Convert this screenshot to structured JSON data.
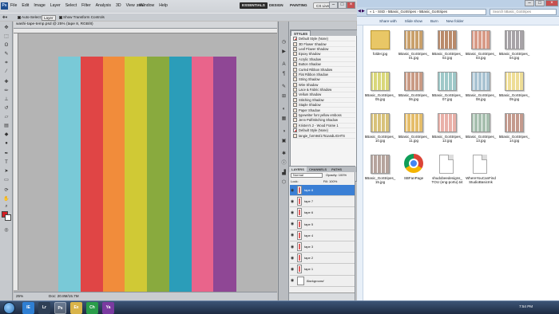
{
  "photoshop": {
    "app_icon": "Ps",
    "menus": [
      "File",
      "Edit",
      "Image",
      "Layer",
      "Select",
      "Filter",
      "Analysis",
      "3D",
      "View",
      "Window",
      "Help"
    ],
    "zoom": "25%",
    "workspaces": [
      "ESSENTIALS",
      "DESIGN",
      "PAINTING"
    ],
    "cs_live": "CS Live",
    "options": {
      "auto_select": "Auto-Select:",
      "layer": "Layer",
      "show_transform": "Show Transform Controls"
    },
    "document_tab": "washi-tape-temp.psd @ 25% (tape 8, RGB/8)",
    "status_zoom": "25%",
    "status_doc": "Doc: 20.8M/15.7M",
    "stripe_colors": [
      "#79c9d7",
      "#e04545",
      "#f18c3b",
      "#d0c935",
      "#89aa3e",
      "#2b9db9",
      "#e9648b",
      "#8f4795"
    ],
    "fg_color": "#d31e23",
    "bg_color": "#ffffff"
  },
  "styles_panel": {
    "tab": "STYLES",
    "items": [
      "Default Style (None)",
      "3D Flower Shadow",
      "Leaf Flower Shadow",
      "Epoxy Shadow",
      "Acrylic Shadow",
      "Button Shadow",
      "Curled Ribbon Shadow",
      "Flat Ribbon Shadow",
      "String Shadow",
      "Wire Shadow",
      "Lace & Fabric Shadow",
      "Vellum Shadow",
      "Stitching Shadow",
      "Staple Shadow",
      "Paper Shadow",
      "typewriter font yellow emboss",
      "Jenn Paf/Stitching Shadow",
      "Kristen's 2 - Wood Frame 1",
      "Default Style (None)",
      "tangie_form94/1751andLIGHTS"
    ]
  },
  "layers_panel": {
    "tabs": [
      "LAYERS",
      "CHANNELS",
      "PATHS"
    ],
    "blend": "Normal",
    "opacity": "Opacity: 100%",
    "lock": "Lock:",
    "fill": "Fill: 100%",
    "layers": [
      "tape 8",
      "tape 7",
      "tape 6",
      "tape 5",
      "tape 4",
      "tape 3",
      "tape 2",
      "tape 1",
      "Background"
    ]
  },
  "explorer": {
    "breadcrumb": "« 1 - SSD › 5Basic_GoStripes › 5Basic_GoStripes",
    "search_placeholder": "Search 5Basic_GoStripes",
    "toolbar": [
      "Share with",
      "Slide show",
      "Burn",
      "New folder"
    ],
    "files": [
      {
        "name": "folder.jpg",
        "type": "folder",
        "color": "#e9c766"
      },
      {
        "name": "5Basic_GoStripes_01.jpg",
        "type": "image",
        "color": "#c9a06b"
      },
      {
        "name": "5Basic_GoStripes_02.jpg",
        "type": "image",
        "color": "#b98a6a"
      },
      {
        "name": "5Basic_GoStripes_03.jpg",
        "type": "image",
        "color": "#d89a86"
      },
      {
        "name": "5Basic_GoStripes_04.jpg",
        "type": "image",
        "color": "#a7a3a7"
      },
      {
        "name": "5Basic_GoStripes_05.jpg",
        "type": "image",
        "color": "#d9d77a"
      },
      {
        "name": "5Basic_GoStripes_06.jpg",
        "type": "image",
        "color": "#c99a84"
      },
      {
        "name": "5Basic_GoStripes_07.jpg",
        "type": "image",
        "color": "#9ec8c8"
      },
      {
        "name": "5Basic_GoStripes_08.jpg",
        "type": "image",
        "color": "#a9c3d2"
      },
      {
        "name": "5Basic_GoStripes_09.jpg",
        "type": "image",
        "color": "#eedd96"
      },
      {
        "name": "5Basic_GoStripes_10.jpg",
        "type": "image",
        "color": "#d8c27a"
      },
      {
        "name": "5Basic_GoStripes_11.jpg",
        "type": "image",
        "color": "#e5bd6a"
      },
      {
        "name": "5Basic_GoStripes_12.jpg",
        "type": "image",
        "color": "#e9b0a8"
      },
      {
        "name": "5Basic_GoStripes_13.jpg",
        "type": "image",
        "color": "#a6bfae"
      },
      {
        "name": "5Basic_GoStripes_14.jpg",
        "type": "image",
        "color": "#c49a8d"
      },
      {
        "name": "5Basic_GoStripes_15.jpg",
        "type": "image",
        "color": "#b6a49d"
      },
      {
        "name": "SBFanPage",
        "type": "chrome",
        "color": ""
      },
      {
        "name": "shudobeedesigns_TOU (eng-portu).txt",
        "type": "doc",
        "color": ""
      },
      {
        "name": "WhereYouCanFindStudioBasicInk",
        "type": "doc",
        "color": ""
      }
    ]
  },
  "taskbar": {
    "apps": [
      "IE",
      "Lr",
      "Ps",
      "Ex",
      "Ch",
      "Ya"
    ],
    "active": "Ps",
    "tray_time": "7:54 PM"
  }
}
